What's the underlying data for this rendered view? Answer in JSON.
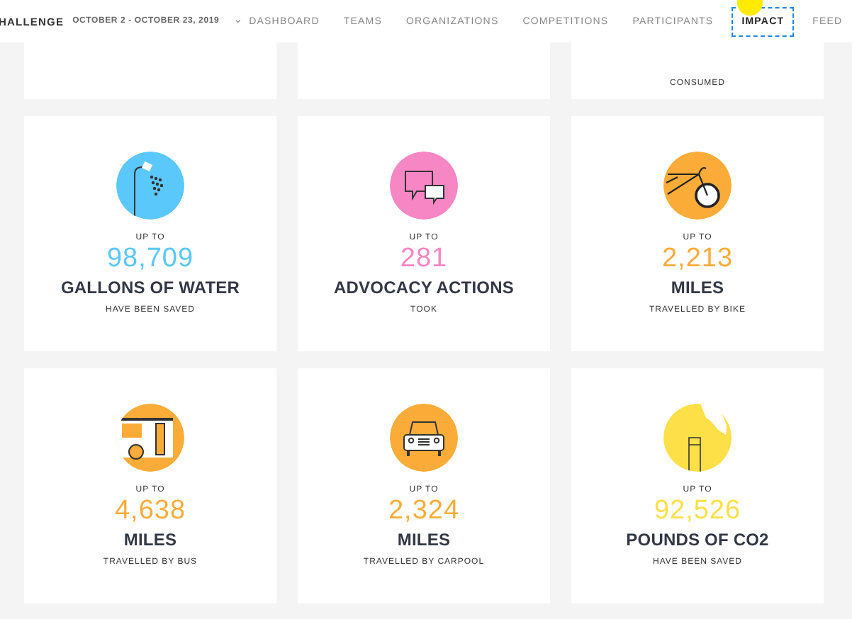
{
  "header": {
    "brand": "HALLENGE",
    "date_range": "OCTOBER 2 - OCTOBER 23, 2019",
    "chevron": "⌄"
  },
  "nav": [
    {
      "label": "DASHBOARD",
      "selected": false
    },
    {
      "label": "TEAMS",
      "selected": false
    },
    {
      "label": "ORGANIZATIONS",
      "selected": false
    },
    {
      "label": "COMPETITIONS",
      "selected": false
    },
    {
      "label": "PARTICIPANTS",
      "selected": false
    },
    {
      "label": "IMPACT",
      "selected": true
    },
    {
      "label": "FEED",
      "selected": false
    }
  ],
  "top_cards": [
    {
      "kind": "blank"
    },
    {
      "kind": "blank"
    },
    {
      "kind": "caption",
      "caption": "CONSUMED"
    }
  ],
  "cards": [
    {
      "kind": "shower",
      "color": "#5bc8fb",
      "prefix": "UP TO",
      "value": "98,709",
      "title": "GALLONS OF WATER",
      "caption": "HAVE BEEN SAVED"
    },
    {
      "kind": "chat",
      "color": "#f786c4",
      "prefix": "UP TO",
      "value": "281",
      "title": "ADVOCACY ACTIONS",
      "caption": "TOOK"
    },
    {
      "kind": "bike",
      "color": "#fbac38",
      "prefix": "UP TO",
      "value": "2,213",
      "title": "MILES",
      "caption": "TRAVELLED BY BIKE"
    },
    {
      "kind": "bus",
      "color": "#fbac38",
      "prefix": "UP TO",
      "value": "4,638",
      "title": "MILES",
      "caption": "TRAVELLED BY BUS"
    },
    {
      "kind": "car",
      "color": "#fbac38",
      "prefix": "UP TO",
      "value": "2,324",
      "title": "MILES",
      "caption": "TRAVELLED BY CARPOOL"
    },
    {
      "kind": "smoke",
      "color": "#fde047",
      "prefix": "UP TO",
      "value": "92,526",
      "title": "POUNDS OF CO2",
      "caption": "HAVE BEEN SAVED"
    }
  ]
}
